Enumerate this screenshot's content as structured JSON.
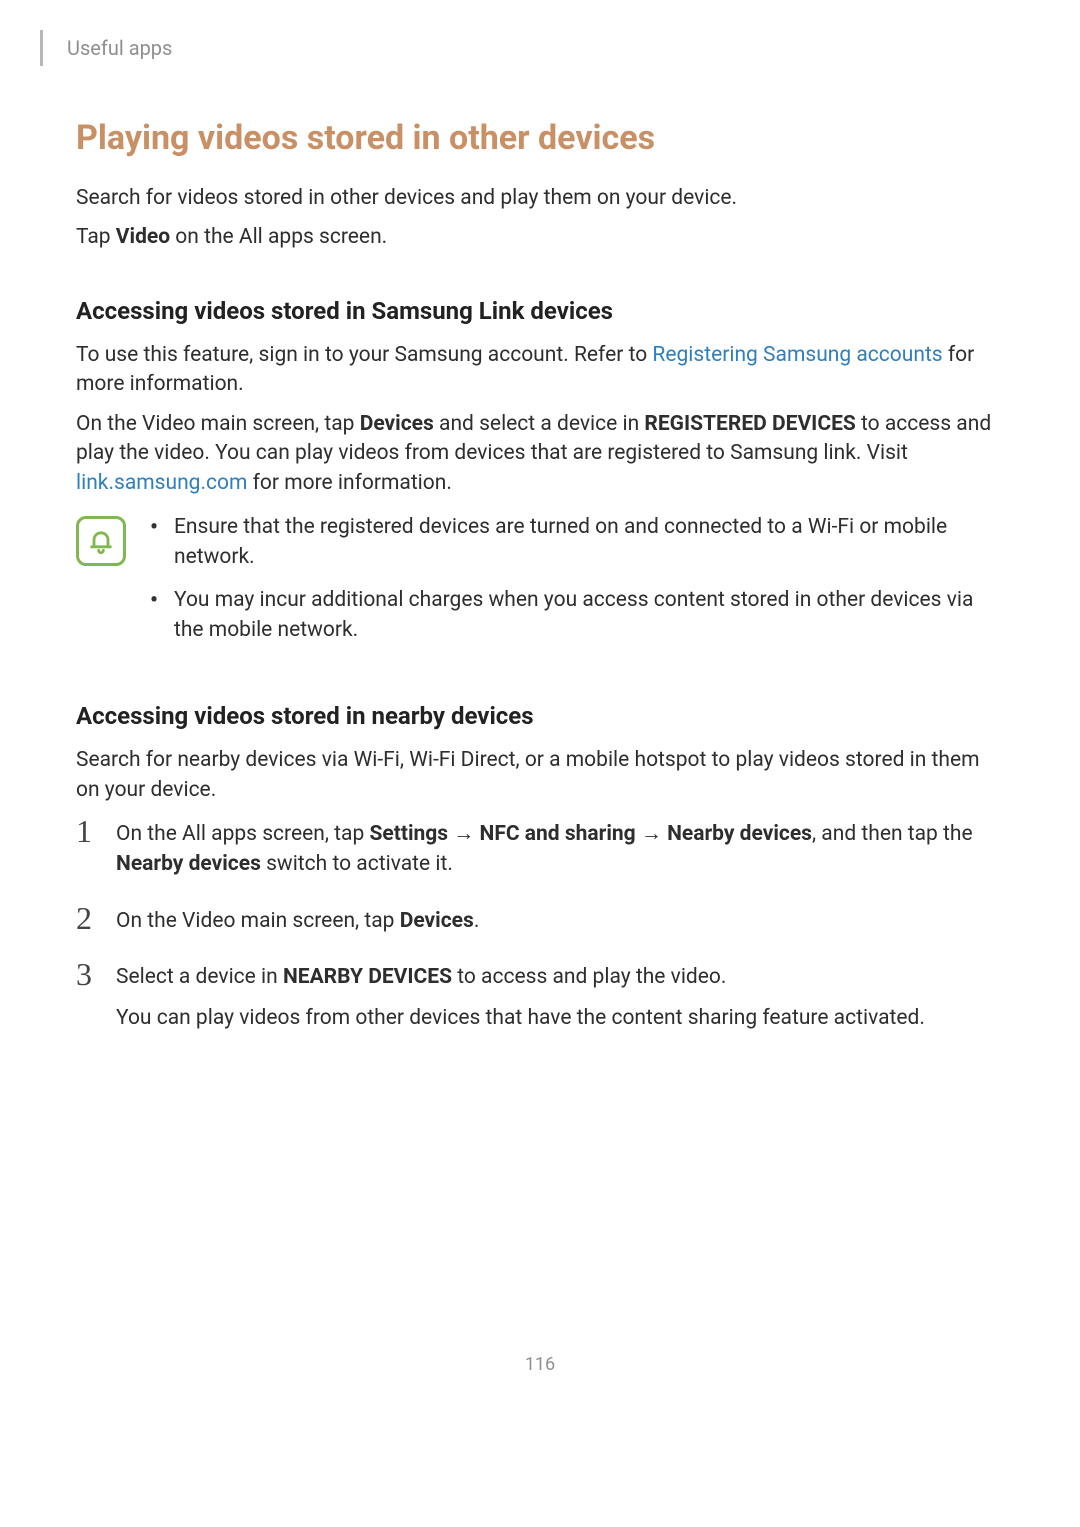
{
  "header": {
    "breadcrumb": "Useful apps"
  },
  "title": "Playing videos stored in other devices",
  "intro1": "Search for videos stored in other devices and play them on your device.",
  "intro2_pre": "Tap ",
  "intro2_bold": "Video",
  "intro2_post": " on the All apps screen.",
  "section1": {
    "heading": "Accessing videos stored in Samsung Link devices",
    "p1_pre": "To use this feature, sign in to your Samsung account. Refer to ",
    "p1_link": "Registering Samsung accounts",
    "p1_post": " for more information.",
    "p2_pre": "On the Video main screen, tap ",
    "p2_devices": "Devices",
    "p2_mid": " and select a device in ",
    "p2_reg": "REGISTERED DEVICES",
    "p2_post": " to access and play the video. You can play videos from devices that are registered to Samsung link. Visit ",
    "p2_link": "link.samsung.com",
    "p2_end": " for more information."
  },
  "notes": {
    "0": "Ensure that the registered devices are turned on and connected to a Wi-Fi or mobile network.",
    "1": "You may incur additional charges when you access content stored in other devices via the mobile network."
  },
  "section2": {
    "heading": "Accessing videos stored in nearby devices",
    "intro": "Search for nearby devices via Wi-Fi, Wi-Fi Direct, or a mobile hotspot to play videos stored in them on your device."
  },
  "steps": {
    "0": {
      "num": "1",
      "pre": "On the All apps screen, tap ",
      "settings": "Settings",
      "arrow1": " → ",
      "nfc": "NFC and sharing",
      "arrow2": " → ",
      "nearby": "Nearby devices",
      "mid": ", and then tap the ",
      "switch": "Nearby devices",
      "post": " switch to activate it."
    },
    "1": {
      "num": "2",
      "pre": "On the Video main screen, tap ",
      "devices": "Devices",
      "post": "."
    },
    "2": {
      "num": "3",
      "pre": "Select a device in ",
      "nearby": "NEARBY DEVICES",
      "post": " to access and play the video.",
      "sub": "You can play videos from other devices that have the content sharing feature activated."
    }
  },
  "page_number": "116"
}
